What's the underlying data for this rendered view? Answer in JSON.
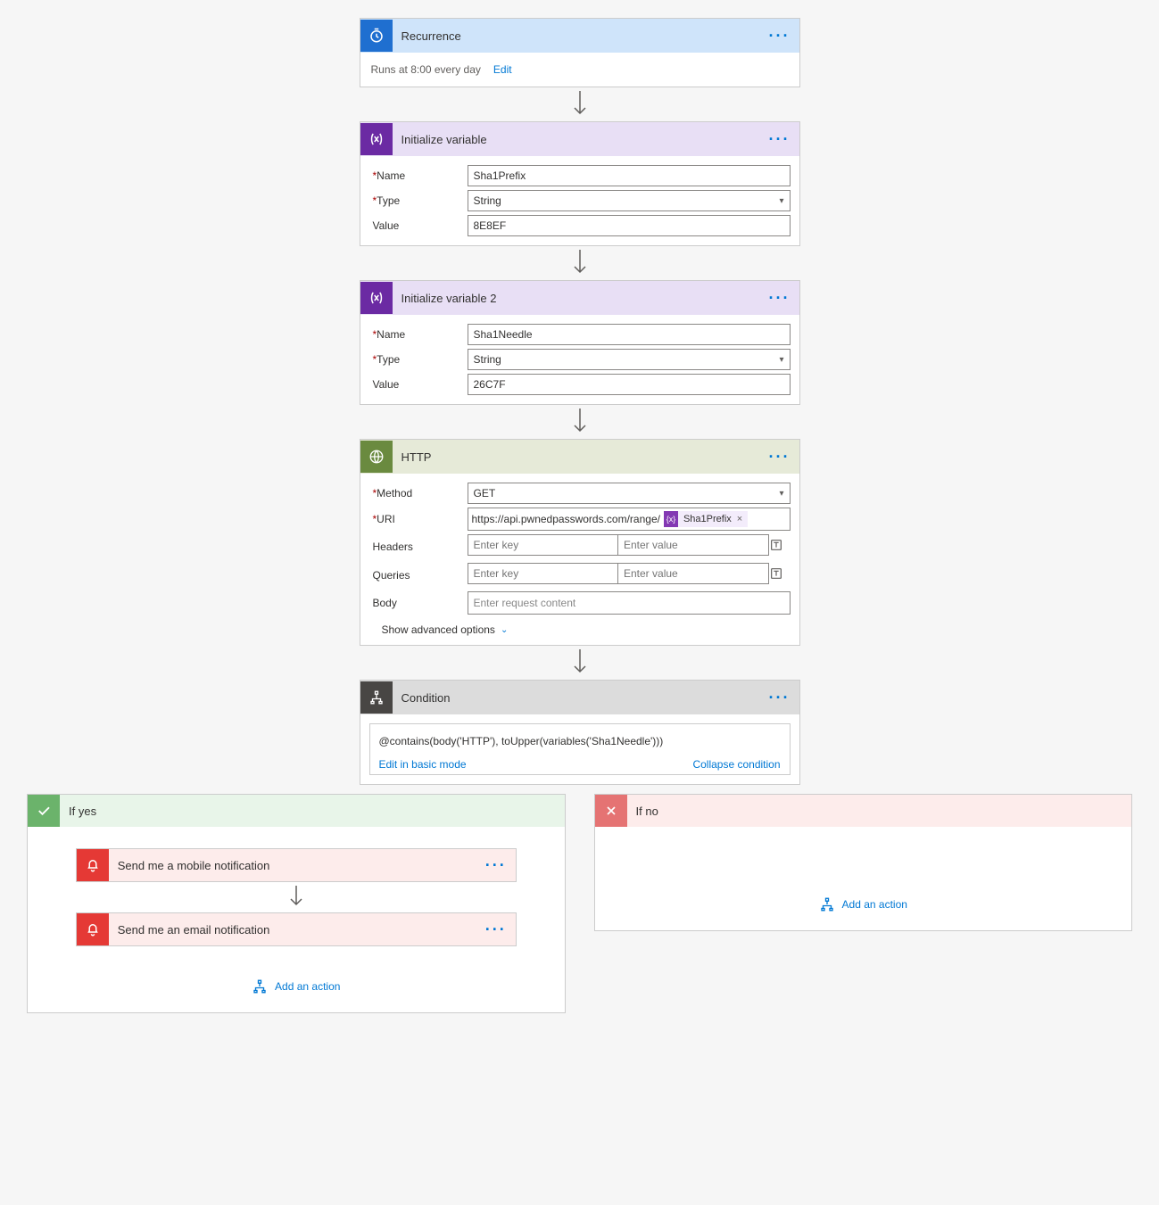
{
  "recurrence": {
    "title": "Recurrence",
    "schedule": "Runs at 8:00 every day",
    "edit": "Edit"
  },
  "var1": {
    "title": "Initialize variable",
    "name_label": "Name",
    "name_value": "Sha1Prefix",
    "type_label": "Type",
    "type_value": "String",
    "value_label": "Value",
    "value_value": "8E8EF"
  },
  "var2": {
    "title": "Initialize variable 2",
    "name_label": "Name",
    "name_value": "Sha1Needle",
    "type_label": "Type",
    "type_value": "String",
    "value_label": "Value",
    "value_value": "26C7F"
  },
  "http": {
    "title": "HTTP",
    "method_label": "Method",
    "method_value": "GET",
    "uri_label": "URI",
    "uri_prefix": "https://api.pwnedpasswords.com/range/",
    "uri_pill": "Sha1Prefix",
    "headers_label": "Headers",
    "key_ph": "Enter key",
    "val_ph": "Enter value",
    "queries_label": "Queries",
    "body_label": "Body",
    "body_ph": "Enter request content",
    "advanced": "Show advanced options"
  },
  "condition": {
    "title": "Condition",
    "expr": "@contains(body('HTTP'), toUpper(variables('Sha1Needle')))",
    "edit_basic": "Edit in basic mode",
    "collapse": "Collapse condition"
  },
  "yes": {
    "title": "If yes",
    "a1": "Send me a mobile notification",
    "a2": "Send me an email notification",
    "add": "Add an action"
  },
  "no": {
    "title": "If no",
    "add": "Add an action"
  }
}
